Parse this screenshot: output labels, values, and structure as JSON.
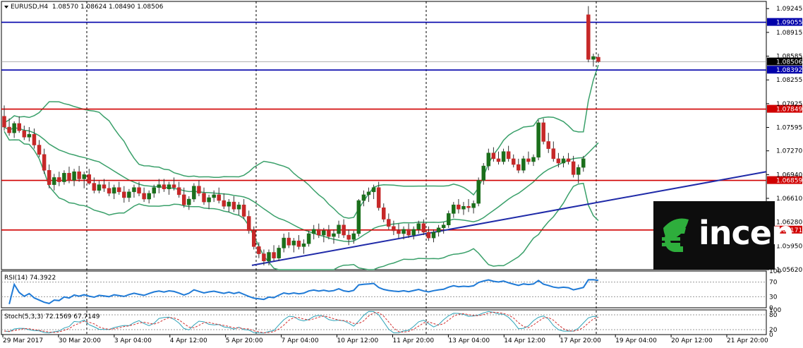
{
  "header": {
    "symbol": "EURUSD,H4",
    "ohlc": "1.08570 1.08624 1.08490 1.08506"
  },
  "rsi": {
    "label": "RSI(14) 74.3922",
    "levels": [
      "100",
      "70",
      "30",
      "0"
    ]
  },
  "stoch": {
    "label": "Stoch(5,3,3) 72.1569 67.7149",
    "levels": [
      "100",
      "80",
      "20",
      "0"
    ]
  },
  "logo": {
    "text": "incen"
  },
  "colors": {
    "bullish": "#1b6f1b",
    "bearish": "#c62828",
    "bands": "#3aa06a",
    "support_resistance": "#d00000",
    "blue_levels": "#0000aa",
    "trendline": "#1f2aa8",
    "rsi_line": "#1f7ad6",
    "stoch_main": "#2fa3b8",
    "stoch_signal": "#d23030"
  },
  "chart_data": {
    "type": "candlestick",
    "ylim": [
      1.0562,
      1.09345
    ],
    "y_ticks": [
      "1.09245",
      "1.08915",
      "1.08585",
      "1.08255",
      "1.07925",
      "1.07595",
      "1.07270",
      "1.06940",
      "1.06610",
      "1.06280",
      "1.05950",
      "1.05620"
    ],
    "x_ticks": [
      "29 Mar 2017",
      "30 Mar 20:00",
      "3 Apr 04:00",
      "4 Apr 12:00",
      "5 Apr 20:00",
      "7 Apr 04:00",
      "10 Apr 12:00",
      "11 Apr 20:00",
      "13 Apr 04:00",
      "14 Apr 12:00",
      "17 Apr 20:00",
      "19 Apr 04:00",
      "20 Apr 12:00",
      "21 Apr 20:00"
    ],
    "price_labels": [
      {
        "value": 1.09055,
        "text": "1.09055",
        "kind": "blue"
      },
      {
        "value": 1.08506,
        "text": "1.08506",
        "kind": "current"
      },
      {
        "value": 1.08392,
        "text": "1.08392",
        "kind": "blue"
      },
      {
        "value": 1.07849,
        "text": "1.07849",
        "kind": "red"
      },
      {
        "value": 1.06859,
        "text": "1.06859",
        "kind": "red"
      },
      {
        "value": 1.06171,
        "text": "1.06171",
        "kind": "red"
      }
    ],
    "trendline": {
      "from": [
        0.325,
        1.0568
      ],
      "to": [
        1.0,
        1.0698
      ]
    },
    "candles": [
      [
        1.0775,
        1.079,
        1.0755,
        1.076
      ],
      [
        1.076,
        1.0772,
        1.0748,
        1.0752
      ],
      [
        1.0752,
        1.0768,
        1.0745,
        1.0765
      ],
      [
        1.0765,
        1.0775,
        1.0752,
        1.0755
      ],
      [
        1.0755,
        1.0762,
        1.0742,
        1.0746
      ],
      [
        1.0746,
        1.076,
        1.074,
        1.075
      ],
      [
        1.075,
        1.0758,
        1.073,
        1.0735
      ],
      [
        1.0735,
        1.0742,
        1.0718,
        1.0722
      ],
      [
        1.0722,
        1.073,
        1.0695,
        1.07
      ],
      [
        1.07,
        1.0708,
        1.0675,
        1.068
      ],
      [
        1.068,
        1.0695,
        1.0672,
        1.069
      ],
      [
        1.069,
        1.0698,
        1.0678,
        1.0684
      ],
      [
        1.0684,
        1.07,
        1.068,
        1.0696
      ],
      [
        1.0696,
        1.0705,
        1.0682,
        1.0686
      ],
      [
        1.0686,
        1.0702,
        1.0678,
        1.0698
      ],
      [
        1.0698,
        1.0706,
        1.0684,
        1.0688
      ],
      [
        1.0688,
        1.0698,
        1.0675,
        1.0694
      ],
      [
        1.0694,
        1.0702,
        1.068,
        1.0682
      ],
      [
        1.0682,
        1.069,
        1.0668,
        1.0672
      ],
      [
        1.0672,
        1.0685,
        1.0668,
        1.068
      ],
      [
        1.068,
        1.0688,
        1.067,
        1.0675
      ],
      [
        1.0675,
        1.0684,
        1.0664,
        1.0668
      ],
      [
        1.0668,
        1.068,
        1.066,
        1.0676
      ],
      [
        1.0676,
        1.0684,
        1.0666,
        1.067
      ],
      [
        1.067,
        1.0678,
        1.0655,
        1.0662
      ],
      [
        1.0662,
        1.0674,
        1.0656,
        1.067
      ],
      [
        1.067,
        1.068,
        1.0662,
        1.0676
      ],
      [
        1.0676,
        1.0684,
        1.0664,
        1.0668
      ],
      [
        1.0668,
        1.0676,
        1.0656,
        1.066
      ],
      [
        1.066,
        1.0672,
        1.0654,
        1.0668
      ],
      [
        1.0668,
        1.068,
        1.0662,
        1.0676
      ],
      [
        1.0676,
        1.0688,
        1.0668,
        1.068
      ],
      [
        1.068,
        1.0688,
        1.067,
        1.0674
      ],
      [
        1.0674,
        1.0684,
        1.0666,
        1.068
      ],
      [
        1.068,
        1.069,
        1.0672,
        1.0676
      ],
      [
        1.0676,
        1.0684,
        1.0662,
        1.0666
      ],
      [
        1.0666,
        1.0676,
        1.0648,
        1.0652
      ],
      [
        1.0652,
        1.0664,
        1.0645,
        1.066
      ],
      [
        1.066,
        1.0682,
        1.0656,
        1.0678
      ],
      [
        1.0678,
        1.0686,
        1.0664,
        1.0668
      ],
      [
        1.0668,
        1.0676,
        1.0652,
        1.0656
      ],
      [
        1.0656,
        1.0666,
        1.0646,
        1.0662
      ],
      [
        1.0662,
        1.0672,
        1.0656,
        1.0666
      ],
      [
        1.0666,
        1.0676,
        1.0654,
        1.0658
      ],
      [
        1.0658,
        1.0668,
        1.0646,
        1.065
      ],
      [
        1.065,
        1.066,
        1.0642,
        1.0656
      ],
      [
        1.0656,
        1.0664,
        1.0642,
        1.0646
      ],
      [
        1.0646,
        1.0656,
        1.0638,
        1.0652
      ],
      [
        1.0652,
        1.066,
        1.0632,
        1.0636
      ],
      [
        1.0636,
        1.0644,
        1.0612,
        1.0616
      ],
      [
        1.0616,
        1.0622,
        1.059,
        1.0594
      ],
      [
        1.0594,
        1.06,
        1.0578,
        1.0584
      ],
      [
        1.0584,
        1.059,
        1.0568,
        1.0574
      ],
      [
        1.0574,
        1.059,
        1.0568,
        1.0586
      ],
      [
        1.0586,
        1.0596,
        1.0574,
        1.0578
      ],
      [
        1.0578,
        1.0596,
        1.0574,
        1.0592
      ],
      [
        1.0592,
        1.0612,
        1.0586,
        1.0606
      ],
      [
        1.0606,
        1.0614,
        1.0592,
        1.0596
      ],
      [
        1.0596,
        1.0606,
        1.0586,
        1.0602
      ],
      [
        1.0602,
        1.061,
        1.059,
        1.0594
      ],
      [
        1.0594,
        1.0604,
        1.0584,
        1.0598
      ],
      [
        1.0598,
        1.0616,
        1.0594,
        1.0612
      ],
      [
        1.0612,
        1.0624,
        1.0604,
        1.0618
      ],
      [
        1.0618,
        1.0626,
        1.0606,
        1.061
      ],
      [
        1.061,
        1.062,
        1.06,
        1.0616
      ],
      [
        1.0616,
        1.0624,
        1.0604,
        1.0608
      ],
      [
        1.0608,
        1.0618,
        1.0598,
        1.0612
      ],
      [
        1.0612,
        1.063,
        1.0606,
        1.0624
      ],
      [
        1.0624,
        1.0632,
        1.0606,
        1.061
      ],
      [
        1.061,
        1.0618,
        1.0596,
        1.0604
      ],
      [
        1.0604,
        1.0616,
        1.0598,
        1.0612
      ],
      [
        1.0612,
        1.066,
        1.0608,
        1.0658
      ],
      [
        1.0658,
        1.0672,
        1.065,
        1.0666
      ],
      [
        1.0666,
        1.0676,
        1.0656,
        1.067
      ],
      [
        1.067,
        1.068,
        1.066,
        1.0676
      ],
      [
        1.0676,
        1.0684,
        1.0644,
        1.0648
      ],
      [
        1.0648,
        1.0654,
        1.0628,
        1.0632
      ],
      [
        1.0632,
        1.064,
        1.0618,
        1.0622
      ],
      [
        1.0622,
        1.063,
        1.061,
        1.0616
      ],
      [
        1.0616,
        1.0626,
        1.0606,
        1.0612
      ],
      [
        1.0612,
        1.0622,
        1.0604,
        1.0618
      ],
      [
        1.0618,
        1.0626,
        1.0606,
        1.061
      ],
      [
        1.061,
        1.0622,
        1.0604,
        1.0618
      ],
      [
        1.0618,
        1.063,
        1.0612,
        1.0626
      ],
      [
        1.0626,
        1.0632,
        1.061,
        1.0614
      ],
      [
        1.0614,
        1.0622,
        1.0602,
        1.0606
      ],
      [
        1.0606,
        1.0618,
        1.06,
        1.0614
      ],
      [
        1.0614,
        1.0624,
        1.0608,
        1.062
      ],
      [
        1.062,
        1.0628,
        1.0612,
        1.0624
      ],
      [
        1.0624,
        1.0644,
        1.062,
        1.064
      ],
      [
        1.064,
        1.0656,
        1.0634,
        1.0652
      ],
      [
        1.0652,
        1.066,
        1.064,
        1.0646
      ],
      [
        1.0646,
        1.0656,
        1.0638,
        1.065
      ],
      [
        1.065,
        1.066,
        1.0642,
        1.0648
      ],
      [
        1.0648,
        1.0658,
        1.064,
        1.0654
      ],
      [
        1.0654,
        1.069,
        1.065,
        1.0686
      ],
      [
        1.0686,
        1.071,
        1.068,
        1.0706
      ],
      [
        1.0706,
        1.073,
        1.07,
        1.0724
      ],
      [
        1.0724,
        1.0732,
        1.0712,
        1.0716
      ],
      [
        1.0716,
        1.0726,
        1.0708,
        1.0712
      ],
      [
        1.0712,
        1.073,
        1.0708,
        1.0726
      ],
      [
        1.0726,
        1.0734,
        1.0712,
        1.0716
      ],
      [
        1.0716,
        1.0722,
        1.0704,
        1.0708
      ],
      [
        1.0708,
        1.0716,
        1.0696,
        1.07
      ],
      [
        1.07,
        1.072,
        1.0696,
        1.0716
      ],
      [
        1.0716,
        1.0726,
        1.0708,
        1.0712
      ],
      [
        1.0712,
        1.0722,
        1.0706,
        1.0718
      ],
      [
        1.0718,
        1.077,
        1.0714,
        1.0766
      ],
      [
        1.0766,
        1.0772,
        1.0736,
        1.074
      ],
      [
        1.074,
        1.0752,
        1.0724,
        1.073
      ],
      [
        1.073,
        1.074,
        1.0712,
        1.0716
      ],
      [
        1.0716,
        1.0724,
        1.0704,
        1.071
      ],
      [
        1.071,
        1.072,
        1.0704,
        1.0716
      ],
      [
        1.0716,
        1.0724,
        1.0708,
        1.0712
      ],
      [
        1.0712,
        1.072,
        1.069,
        1.0694
      ],
      [
        1.0694,
        1.0708,
        1.0682,
        1.0704
      ],
      [
        1.0704,
        1.072,
        1.0698,
        1.0716
      ],
      [
        1.0916,
        1.0928,
        1.085,
        1.0854
      ],
      [
        1.0854,
        1.0862,
        1.0844,
        1.0858
      ],
      [
        1.0857,
        1.0862,
        1.0849,
        1.0851
      ]
    ]
  }
}
